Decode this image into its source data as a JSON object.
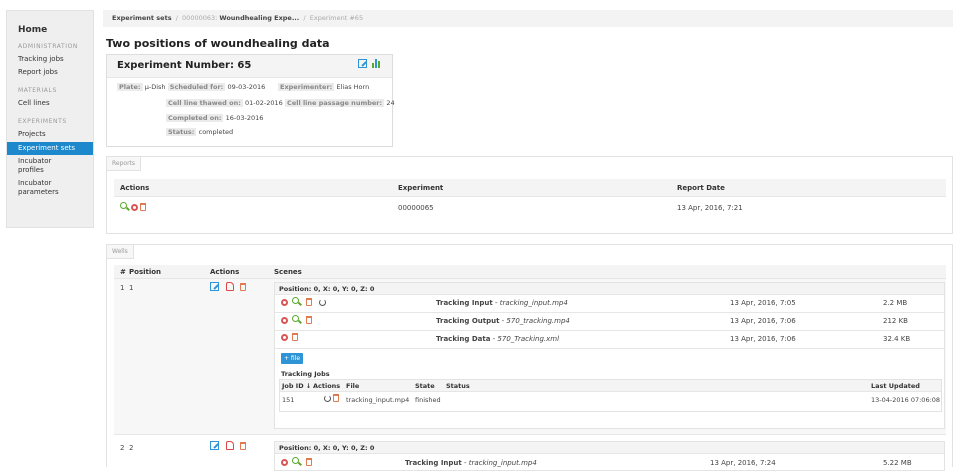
{
  "sidebar": {
    "home": "Home",
    "sections": [
      {
        "title": "ADMINISTRATION",
        "items": [
          "Tracking jobs",
          "Report jobs"
        ]
      },
      {
        "title": "MATERIALS",
        "items": [
          "Cell lines"
        ]
      },
      {
        "title": "EXPERIMENTS",
        "items": [
          "Projects",
          "Experiment sets",
          "Incubator profiles",
          "Incubator parameters"
        ]
      }
    ],
    "active": "Experiment sets",
    "items_flat": {
      "admin_title": "ADMINISTRATION",
      "tracking_jobs": "Tracking jobs",
      "report_jobs": "Report jobs",
      "materials_title": "MATERIALS",
      "cell_lines": "Cell lines",
      "experiments_title": "EXPERIMENTS",
      "projects": "Projects",
      "experiment_sets": "Experiment sets",
      "incubator_profiles_1": "Incubator",
      "incubator_profiles_2": "profiles",
      "incubator_parameters_1": "Incubator",
      "incubator_parameters_2": "parameters"
    }
  },
  "breadcrumb": {
    "root": "Experiment sets",
    "sep": "/",
    "set_id": "00000063:",
    "set_name": "Woundhealing Expe...",
    "current": "Experiment #65"
  },
  "page_title": "Two positions of woundhealing data",
  "experiment": {
    "title": "Experiment Number: 65",
    "plate_label": "Plate:",
    "plate_value": "µ-Dish",
    "scheduled_label": "Scheduled for:",
    "scheduled_value": "09-03-2016",
    "experimenter_label": "Experimenter:",
    "experimenter_value": "Elias Horn",
    "thawed_label": "Cell line thawed on:",
    "thawed_value": "01-02-2016",
    "passage_label": "Cell line passage number:",
    "passage_value": "24",
    "completed_label": "Completed on:",
    "completed_value": "16-03-2016",
    "status_label": "Status:",
    "status_value": "completed"
  },
  "reports": {
    "tab": "Reports",
    "col_actions": "Actions",
    "col_experiment": "Experiment",
    "col_date": "Report Date",
    "rows": [
      {
        "experiment": "00000065",
        "date": "13 Apr, 2016, 7:21"
      }
    ]
  },
  "wells": {
    "tab": "Wells",
    "col_num": "#",
    "col_position": "Position",
    "col_actions": "Actions",
    "col_scenes": "Scenes",
    "rows": [
      {
        "num": "1",
        "position": "1",
        "scene_title": "Position: 0, X: 0, Y: 0, Z: 0",
        "files": [
          {
            "name": "Tracking Input",
            "sep": " - ",
            "file": "tracking_input.mp4",
            "date": "13 Apr, 2016, 7:05",
            "size": "2.2 MB"
          },
          {
            "name": "Tracking Output",
            "sep": " - ",
            "file": "570_tracking.mp4",
            "date": "13 Apr, 2016, 7:06",
            "size": "212 KB"
          },
          {
            "name": "Tracking Data",
            "sep": " - ",
            "file": "570_Tracking.xml",
            "date": "13 Apr, 2016, 7:06",
            "size": "32.4 KB"
          }
        ],
        "add_file": "+ file",
        "jobs_title": "Tracking Jobs",
        "jobs_cols": {
          "id": "Job ID ↓",
          "actions": "Actions",
          "file": "File",
          "state": "State",
          "status": "Status",
          "updated": "Last Updated"
        },
        "jobs": [
          {
            "id": "151",
            "file": "tracking_input.mp4",
            "state": "finished",
            "status": "",
            "updated": "13-04-2016 07:06:08"
          }
        ]
      },
      {
        "num": "2",
        "position": "2",
        "scene_title": "Position: 0, X: 0, Y: 0, Z: 0",
        "files": [
          {
            "name": "Tracking Input",
            "sep": " - ",
            "file": "tracking_input.mp4",
            "date": "13 Apr, 2016, 7:24",
            "size": "5.22 MB"
          }
        ]
      }
    ]
  },
  "colors": {
    "accent": "#1e88cc",
    "edit": "#2e94d6",
    "view": "#5aa92b",
    "delete": "#e07a52",
    "report": "#d85555"
  }
}
